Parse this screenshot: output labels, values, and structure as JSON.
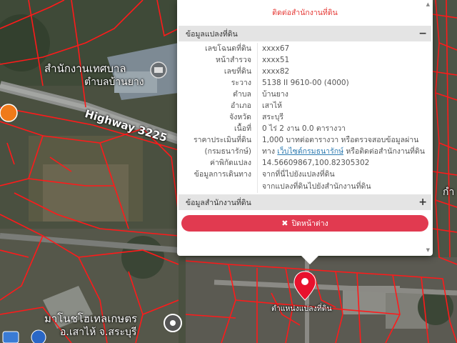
{
  "map": {
    "labels": {
      "municipality": "สำนักงานเทศบาล",
      "subdistrict": "ตำบลบ้านยาง",
      "highway": "Highway 3225",
      "hotel": "มาโนชโฮเทลเกษตร",
      "district": "อ.เสาไห้ จ.สระบุรี",
      "marker_caption": "ตำแหน่งแปลงที่ดิน",
      "right_edge": "กำ"
    },
    "colors": {
      "parcel_line": "#ff1a1a",
      "marker": "#e8112d"
    }
  },
  "popup": {
    "notice_top": "ติดต่อสำนักงานที่ดิน",
    "parcel_section": {
      "title": "ข้อมูลแปลงที่ดิน",
      "toggle": "−",
      "fields": [
        {
          "label": "เลขโฉนดที่ดิน",
          "value": "xxxx67"
        },
        {
          "label": "หน้าสำรวจ",
          "value": "xxxx51"
        },
        {
          "label": "เลขที่ดิน",
          "value": "xxxx82"
        },
        {
          "label": "ระวาง",
          "value": "5138 II 9610-00 (4000)"
        },
        {
          "label": "ตำบล",
          "value": "บ้านยาง"
        },
        {
          "label": "อำเภอ",
          "value": "เสาไห้"
        },
        {
          "label": "จังหวัด",
          "value": "สระบุรี"
        },
        {
          "label": "เนื้อที่",
          "value": "0 ไร่ 2 งาน 0.0 ตารางวา"
        }
      ],
      "price": {
        "label_line1": "ราคาประเมินที่ดิน",
        "label_line2": "(กรมธนารักษ์)",
        "value_line1": "1,000 บาทต่อตารางวา หรือตรวจสอบข้อมูลผ่าน",
        "value_line2_pre": "ทาง ",
        "value_line2_link": "เว็บไซต์กรมธนารักษ์",
        "value_line2_post": " หรือติดต่อสำนักงานที่ดิน"
      },
      "coords": {
        "label": "ค่าพิกัดแปลง",
        "value": "14.56609867,100.82305302"
      },
      "directions": {
        "label": "ข้อมูลการเดินทาง",
        "link1": "จากที่นี่ไปยังแปลงที่ดิน",
        "link2": "จากแปลงที่ดินไปยังสำนักงานที่ดิน"
      }
    },
    "office_section": {
      "title": "ข้อมูลสำนักงานที่ดิน",
      "toggle": "+"
    },
    "close_label": "ปิดหน้าต่าง",
    "close_icon": "x-icon"
  }
}
